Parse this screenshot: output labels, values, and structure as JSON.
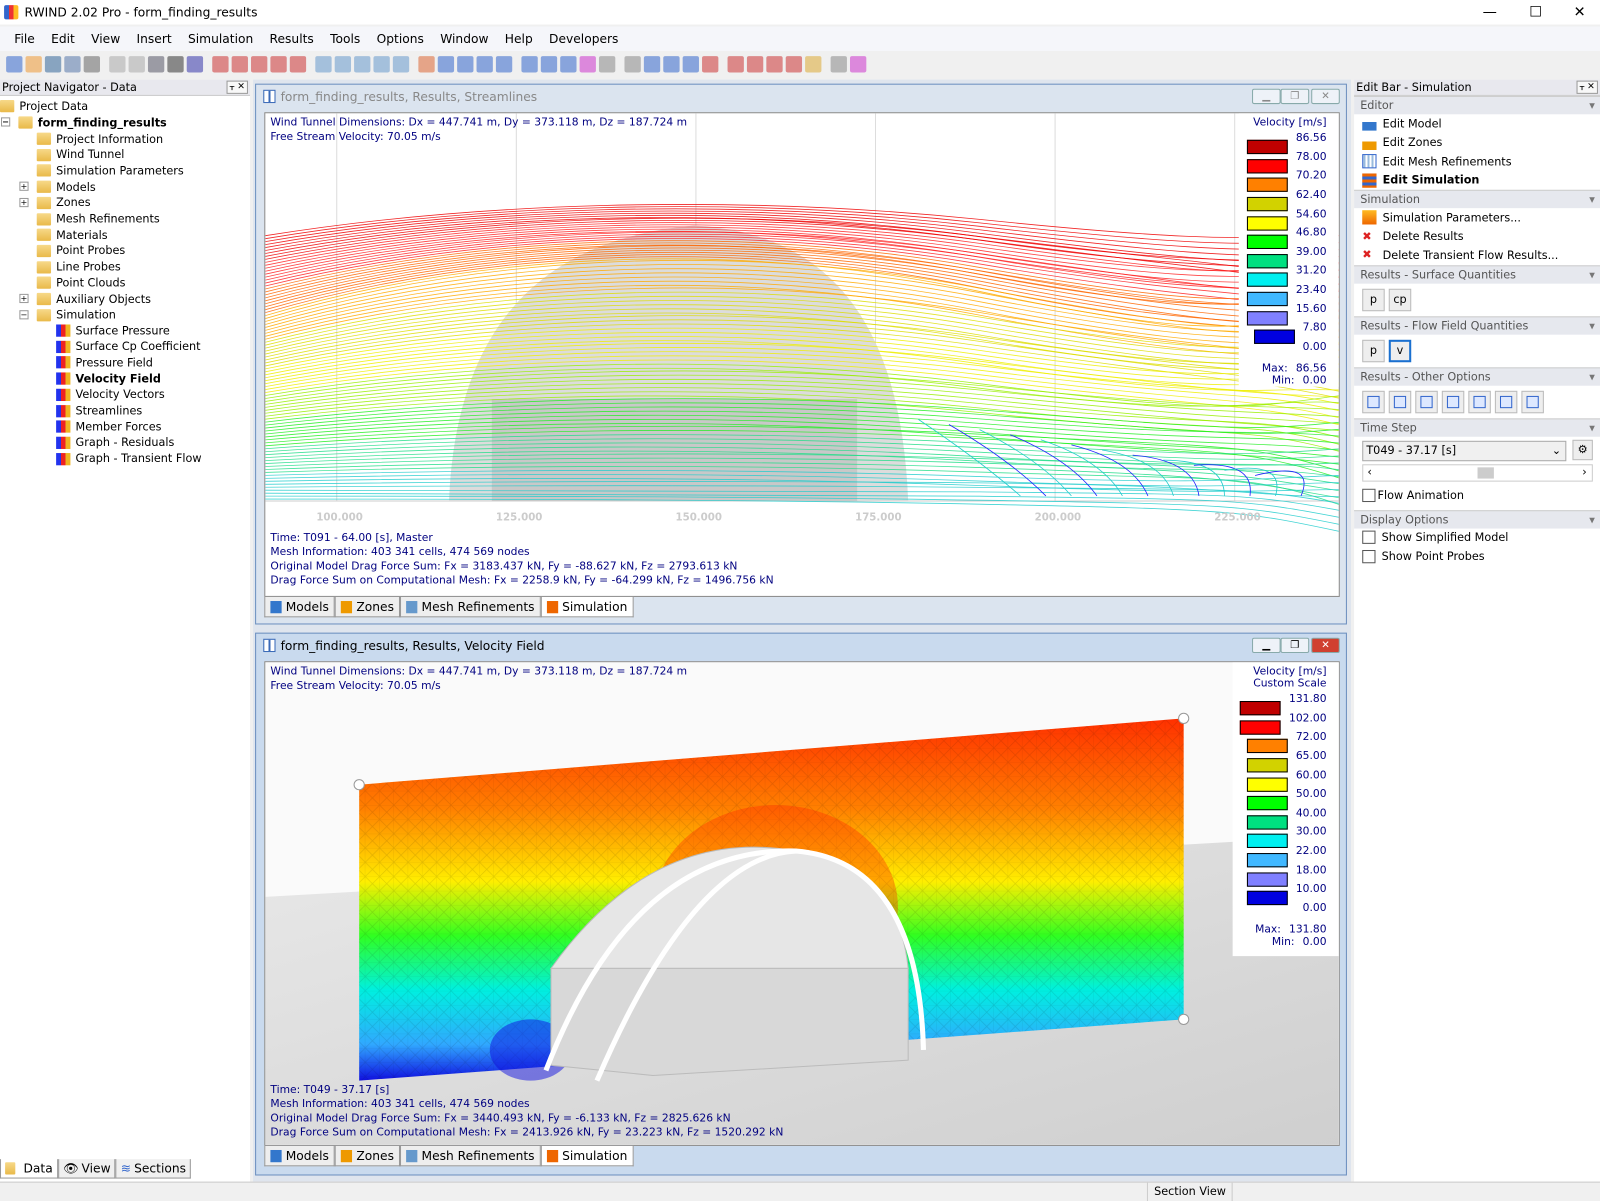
{
  "app": {
    "title": "RWIND 2.02 Pro - form_finding_results"
  },
  "menu": [
    "File",
    "Edit",
    "View",
    "Insert",
    "Simulation",
    "Results",
    "Tools",
    "Options",
    "Window",
    "Help",
    "Developers"
  ],
  "navigator": {
    "title": "Project Navigator - Data",
    "root": "Project Data",
    "project": "form_finding_results",
    "items": [
      "Project Information",
      "Wind Tunnel",
      "Simulation Parameters",
      "Models",
      "Zones",
      "Mesh Refinements",
      "Materials",
      "Point Probes",
      "Line Probes",
      "Point Clouds",
      "Auxiliary Objects",
      "Simulation"
    ],
    "simulation_items": [
      "Surface Pressure",
      "Surface Cp Coefficient",
      "Pressure Field",
      "Velocity Field",
      "Velocity Vectors",
      "Streamlines",
      "Member Forces",
      "Graph - Residuals",
      "Graph - Transient Flow"
    ],
    "selected": "Velocity Field",
    "tabs": [
      "Data",
      "View",
      "Sections"
    ]
  },
  "view_tabs": [
    "Models",
    "Zones",
    "Mesh Refinements",
    "Simulation"
  ],
  "window1": {
    "title": "form_finding_results, Results, Streamlines",
    "header": [
      "Wind Tunnel Dimensions: Dx = 447.741 m, Dy = 373.118 m, Dz = 187.724 m",
      "Free Stream Velocity: 70.05 m/s"
    ],
    "footer": [
      "Time: T091 - 64.00 [s], Master",
      "Mesh Information: 403 341 cells, 474 569 nodes",
      "Original Model Drag Force Sum: Fx = 3183.437 kN, Fy = -88.627 kN, Fz = 2793.613 kN",
      "Drag Force Sum on Computational Mesh: Fx = 2258.9 kN, Fy = -64.299 kN, Fz = 1496.756 kN"
    ],
    "axis_ticks": [
      "100.000",
      "125.000",
      "150.000",
      "175.000",
      "200.000",
      "225.000"
    ],
    "legend": {
      "title": "Velocity [m/s]",
      "values": [
        "86.56",
        "78.00",
        "70.20",
        "62.40",
        "54.60",
        "46.80",
        "39.00",
        "31.20",
        "23.40",
        "15.60",
        "7.80",
        "0.00"
      ],
      "max_label": "Max:",
      "max": "86.56",
      "min_label": "Min:",
      "min": "0.00"
    }
  },
  "window2": {
    "title": "form_finding_results, Results, Velocity Field",
    "header": [
      "Wind Tunnel Dimensions: Dx = 447.741 m, Dy = 373.118 m, Dz = 187.724 m",
      "Free Stream Velocity: 70.05 m/s"
    ],
    "footer": [
      "Time: T049 - 37.17 [s]",
      "Mesh Information: 403 341 cells, 474 569 nodes",
      "Original Model Drag Force Sum: Fx = 3440.493 kN, Fy = -6.133 kN, Fz = 2825.626 kN",
      "Drag Force Sum on Computational Mesh: Fx = 2413.926 kN, Fy = 23.223 kN, Fz = 1520.292 kN"
    ],
    "legend": {
      "title": "Velocity [m/s]",
      "subtitle": "Custom Scale",
      "values": [
        "131.80",
        "102.00",
        "72.00",
        "65.00",
        "60.00",
        "50.00",
        "40.00",
        "30.00",
        "22.00",
        "18.00",
        "10.00",
        "0.00"
      ],
      "max_label": "Max:",
      "max": "131.80",
      "min_label": "Min:",
      "min": "0.00"
    }
  },
  "legend_colors": [
    "#c00000",
    "#ff0000",
    "#ff8000",
    "#d2d200",
    "#ffff00",
    "#00ff00",
    "#00e080",
    "#00f0f0",
    "#40b8ff",
    "#8080ff",
    "#0000e0"
  ],
  "editbar": {
    "title": "Edit Bar - Simulation",
    "editor": {
      "title": "Editor",
      "items": [
        "Edit Model",
        "Edit Zones",
        "Edit Mesh Refinements",
        "Edit Simulation"
      ]
    },
    "simulation": {
      "title": "Simulation",
      "items": [
        "Simulation Parameters...",
        "Delete Results",
        "Delete Transient Flow Results..."
      ]
    },
    "surface": {
      "title": "Results - Surface Quantities",
      "buttons": [
        "p",
        "cp"
      ]
    },
    "flow": {
      "title": "Results - Flow Field Quantities",
      "buttons": [
        "p",
        "v"
      ]
    },
    "other": {
      "title": "Results - Other Options"
    },
    "timestep": {
      "title": "Time Step",
      "value": "T049 - 37.17 [s]",
      "animation": "Flow Animation"
    },
    "display": {
      "title": "Display Options",
      "items": [
        "Show Simplified Model",
        "Show Point Probes"
      ]
    }
  },
  "status": {
    "section_view": "Section View"
  }
}
